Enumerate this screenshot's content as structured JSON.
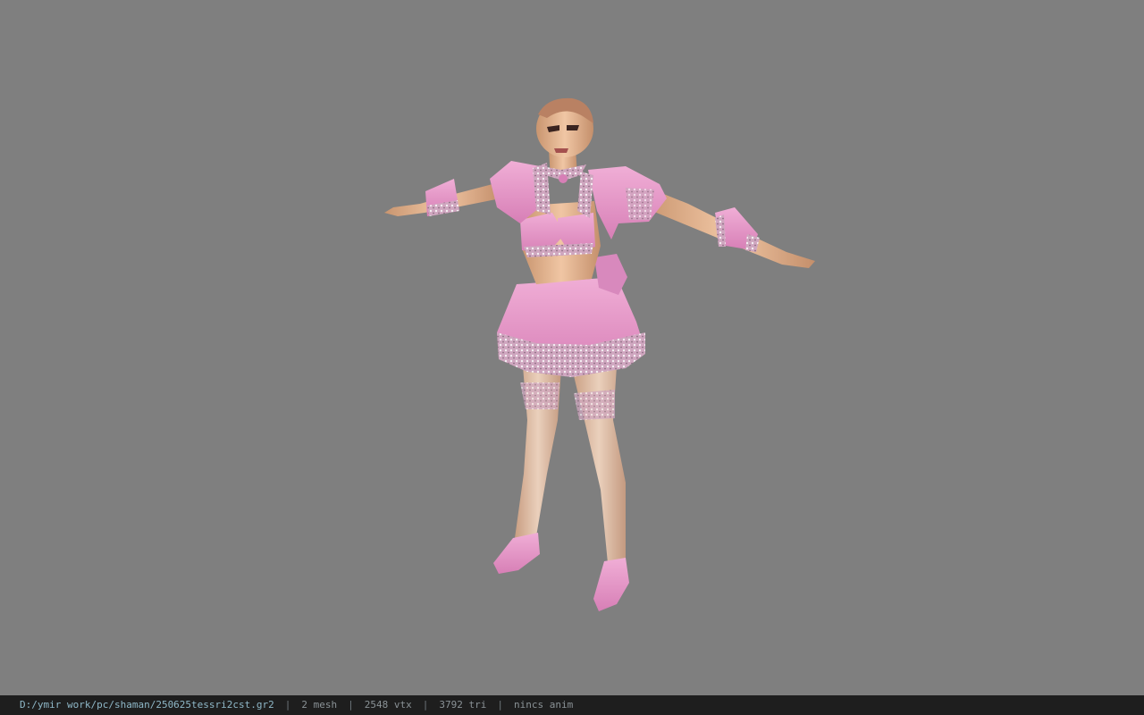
{
  "viewer": {
    "background_color": "#7f7f7f",
    "model": {
      "skin_color": "#e8b995",
      "outfit_color": "#e59ac9",
      "lace_color": "#d9d0d6"
    }
  },
  "status_bar": {
    "file_path": "D:/ymir work/pc/shaman/250625tessri2cst.gr2",
    "separator": "|",
    "mesh_count": "2 mesh",
    "vertex_count": "2548 vtx",
    "triangle_count": "3792 tri",
    "animation": "nincs anim"
  }
}
